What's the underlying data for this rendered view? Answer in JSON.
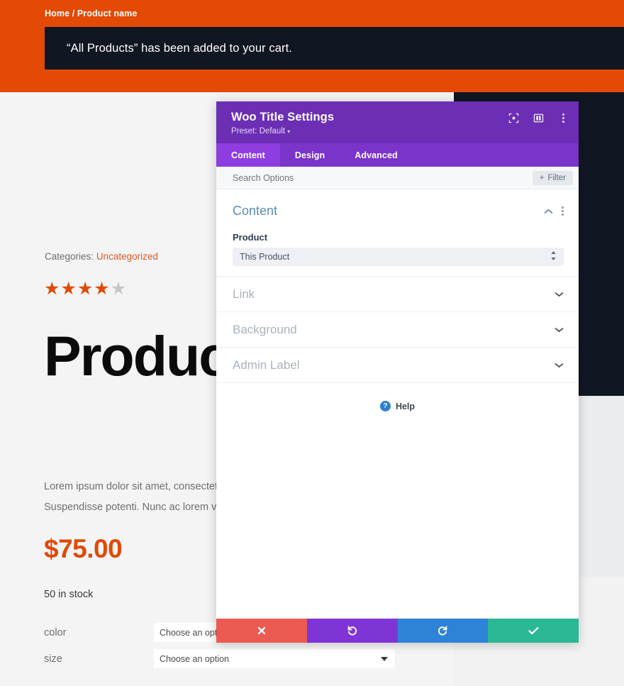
{
  "storefront": {
    "breadcrumb": "Home / Product name",
    "cart_notice": "“All Products” has been added to your cart.",
    "categories_label": "Categories:",
    "categories_value": "Uncategorized",
    "rating_filled": 4,
    "rating_total": 5,
    "product_title": "Product Name",
    "description": "Lorem ipsum dolor sit amet, consectetur adipiscing elit. Cras in dui sed vehicula. Suspendisse potenti. Nunc ac lorem vitae.",
    "price": "$75.00",
    "stock": "50 in stock",
    "variations": [
      {
        "label": "color",
        "value": "Choose an option"
      },
      {
        "label": "size",
        "value": "Choose an option"
      }
    ]
  },
  "modal": {
    "title": "Woo Title Settings",
    "preset": "Preset: Default",
    "preset_caret": "▾",
    "header_icons": [
      "focus-icon",
      "layout-icon",
      "more-options-icon"
    ],
    "tabs": [
      {
        "label": "Content",
        "active": true
      },
      {
        "label": "Design",
        "active": false
      },
      {
        "label": "Advanced",
        "active": false
      }
    ],
    "search_placeholder": "Search Options",
    "search_value": "",
    "filter_label": "Filter",
    "filter_plus": "+",
    "open_section": {
      "title": "Content",
      "field_label": "Product",
      "field_value": "This Product"
    },
    "closed_sections": [
      {
        "title": "Link"
      },
      {
        "title": "Background"
      },
      {
        "title": "Admin Label"
      }
    ],
    "help_label": "Help",
    "help_glyph": "?",
    "footer": [
      {
        "name": "cancel",
        "color": "#eb5b52"
      },
      {
        "name": "undo",
        "color": "#7f35d6"
      },
      {
        "name": "redo",
        "color": "#2c83d8"
      },
      {
        "name": "save",
        "color": "#2bb894"
      }
    ]
  },
  "colors": {
    "brand_orange": "#e24a06",
    "notice_dark": "#111722",
    "purple_header": "#6b2eb5",
    "purple_tabs": "#7a34c9",
    "purple_active": "#8e3ee0",
    "page_bg": "#f4f4f4"
  }
}
